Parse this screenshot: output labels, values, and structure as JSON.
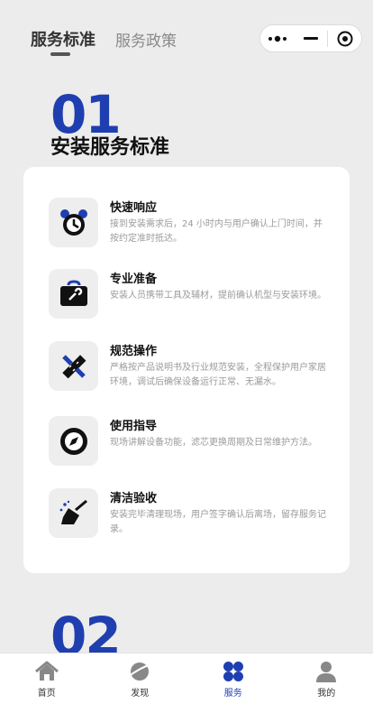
{
  "header": {
    "tabs": [
      {
        "label": "服务标准",
        "active": true
      },
      {
        "label": "服务政策",
        "active": false
      }
    ],
    "capsule": {
      "more_icon": "more-dots-icon",
      "minimize_icon": "minimize-icon",
      "close_icon": "target-close-icon"
    }
  },
  "section1": {
    "number": "01",
    "title": "安装服务标准",
    "items": [
      {
        "icon": "alarm-clock-icon",
        "title": "快速响应",
        "desc": "接到安装需求后，24 小时内与用户确认上门时间，并按约定准时抵达。"
      },
      {
        "icon": "toolbox-icon",
        "title": "专业准备",
        "desc": "安装人员携带工具及辅材，提前确认机型与安装环境。"
      },
      {
        "icon": "ruler-pencil-icon",
        "title": "规范操作",
        "desc": "严格按产品说明书及行业规范安装，全程保护用户家居环境，调试后确保设备运行正常、无漏水。"
      },
      {
        "icon": "compass-icon",
        "title": "使用指导",
        "desc": "现场讲解设备功能，滤芯更换周期及日常维护方法。"
      },
      {
        "icon": "broom-icon",
        "title": "清洁验收",
        "desc": "安装完毕清理现场，用户签字确认后离场，留存服务记录。"
      }
    ]
  },
  "section2": {
    "number": "02"
  },
  "nav": {
    "active_color": "#1f3fb0",
    "items": [
      {
        "label": "首页",
        "icon": "home-icon"
      },
      {
        "label": "发现",
        "icon": "planet-icon"
      },
      {
        "label": "服务",
        "icon": "clover-grid-icon",
        "active": true
      },
      {
        "label": "我的",
        "icon": "user-icon"
      }
    ]
  }
}
